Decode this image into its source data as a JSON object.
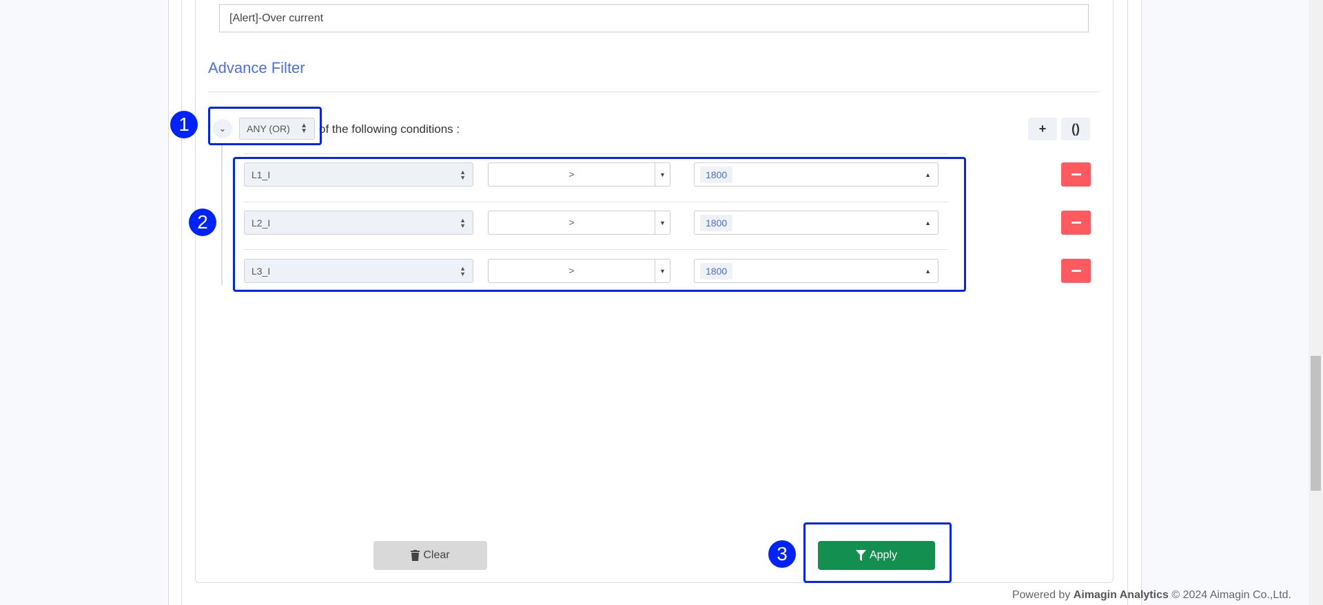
{
  "rule_name_value": "[Alert]-Over current",
  "section_title": "Advance Filter",
  "group": {
    "combinator": "ANY (OR)",
    "suffix": "of the following conditions :",
    "add_rule_label": "+",
    "add_group_label": "()"
  },
  "conditions": [
    {
      "field": "L1_I",
      "operator": ">",
      "value": "1800"
    },
    {
      "field": "L2_I",
      "operator": ">",
      "value": "1800"
    },
    {
      "field": "L3_I",
      "operator": ">",
      "value": "1800"
    }
  ],
  "actions": {
    "clear_label": "Clear",
    "apply_label": "Apply"
  },
  "annotations": [
    "1",
    "2",
    "3"
  ],
  "footer": {
    "prefix": "Powered by",
    "brand": "Aimagin Analytics",
    "suffix": "© 2024 Aimagin Co.,Ltd."
  },
  "colors": {
    "accent": "#4b6fe6",
    "apply": "#138f50",
    "remove": "#ff5a5f",
    "annotation": "#0022ff"
  }
}
